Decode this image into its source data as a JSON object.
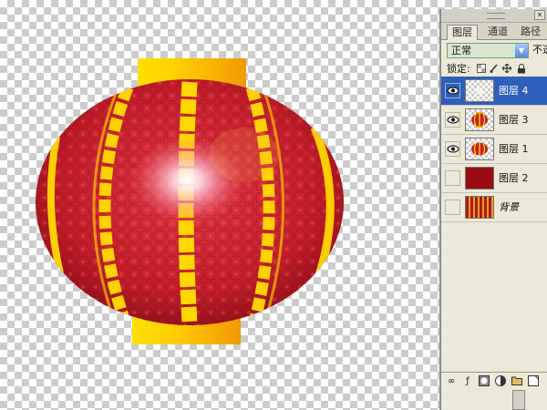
{
  "layers_panel": {
    "tabs": [
      {
        "label": "图层"
      },
      {
        "label": "通道"
      },
      {
        "label": "路径"
      }
    ],
    "blend_mode": "正常",
    "opacity_label": "不透",
    "lock_label": "锁定:",
    "layers": [
      {
        "name": "图层 4",
        "visible": true,
        "selected": true
      },
      {
        "name": "图层 3",
        "visible": true,
        "selected": false
      },
      {
        "name": "图层 1",
        "visible": true,
        "selected": false
      },
      {
        "name": "图层 2",
        "visible": false,
        "selected": false
      },
      {
        "name": "背景",
        "visible": false,
        "selected": false
      }
    ]
  },
  "colors": {
    "lantern_red": "#c41e2a",
    "lantern_stripe": "#ffd200",
    "cap_gold": "#f5b800",
    "selection_blue": "#2e5fba"
  },
  "icons": [
    "eye-icon",
    "lock-transparent-icon",
    "lock-brush-icon",
    "lock-move-icon",
    "lock-all-icon",
    "link-icon",
    "layer-style-icon",
    "mask-icon",
    "new-adjustment-icon",
    "new-group-icon",
    "new-layer-icon",
    "trash-icon",
    "close-icon",
    "dropdown-arrow-icon"
  ]
}
